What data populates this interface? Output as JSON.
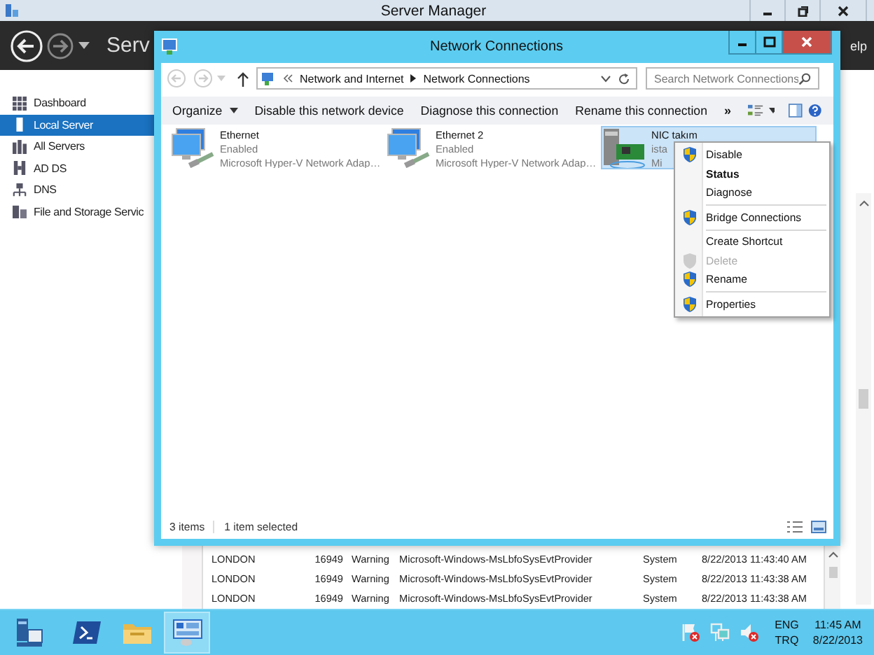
{
  "server_manager": {
    "title": "Server Manager",
    "header_title": "Serv",
    "header_right": "elp",
    "sidebar": [
      {
        "label": "Dashboard",
        "selected": false
      },
      {
        "label": "Local Server",
        "selected": true
      },
      {
        "label": "All Servers",
        "selected": false
      },
      {
        "label": "AD DS",
        "selected": false
      },
      {
        "label": "DNS",
        "selected": false
      },
      {
        "label": "File and Storage Servic",
        "selected": false
      }
    ],
    "events": [
      {
        "server": "LONDON",
        "id": "16949",
        "severity": "Warning",
        "source": "Microsoft-Windows-MsLbfoSysEvtProvider",
        "log": "System",
        "date": "8/22/2013 11:43:40 AM"
      },
      {
        "server": "LONDON",
        "id": "16949",
        "severity": "Warning",
        "source": "Microsoft-Windows-MsLbfoSysEvtProvider",
        "log": "System",
        "date": "8/22/2013 11:43:38 AM"
      },
      {
        "server": "LONDON",
        "id": "16949",
        "severity": "Warning",
        "source": "Microsoft-Windows-MsLbfoSysEvtProvider",
        "log": "System",
        "date": "8/22/2013 11:43:38 AM"
      }
    ]
  },
  "network_connections": {
    "title": "Network Connections",
    "breadcrumb": [
      "Network and Internet",
      "Network Connections"
    ],
    "search": {
      "placeholder": "Search Network Connections"
    },
    "commands": [
      {
        "label": "Organize",
        "dropdown": true
      },
      {
        "label": "Disable this network device",
        "dropdown": false
      },
      {
        "label": "Diagnose this connection",
        "dropdown": false
      },
      {
        "label": "Rename this connection",
        "dropdown": false
      }
    ],
    "more": "»",
    "adapters": [
      {
        "name": "Ethernet",
        "status": "Enabled",
        "device": "Microsoft Hyper-V Network Adap…",
        "kind": "monitor",
        "selected": false
      },
      {
        "name": "Ethernet 2",
        "status": "Enabled",
        "device": "Microsoft Hyper-V Network Adap…",
        "kind": "monitor",
        "selected": false
      },
      {
        "name": "NIC takım",
        "status": "ista",
        "device": "Mi",
        "kind": "card",
        "selected": true
      }
    ],
    "status_bar": {
      "count": "3 items",
      "selection": "1 item selected"
    }
  },
  "context_menu": {
    "groups": [
      [
        {
          "label": "Disable",
          "shield": true,
          "default": false,
          "disabled": false
        },
        {
          "label": "Status",
          "shield": false,
          "default": true,
          "disabled": false
        },
        {
          "label": "Diagnose",
          "shield": false,
          "default": false,
          "disabled": false
        }
      ],
      [
        {
          "label": "Bridge Connections",
          "shield": true,
          "default": false,
          "disabled": false
        }
      ],
      [
        {
          "label": "Create Shortcut",
          "shield": false,
          "default": false,
          "disabled": false
        },
        {
          "label": "Delete",
          "shield": true,
          "default": false,
          "disabled": true
        },
        {
          "label": "Rename",
          "shield": true,
          "default": false,
          "disabled": false
        }
      ],
      [
        {
          "label": "Properties",
          "shield": true,
          "default": false,
          "disabled": false
        }
      ]
    ]
  },
  "taskbar": {
    "apps": [
      {
        "kind": "powershell",
        "selected": false
      },
      {
        "kind": "explorer",
        "selected": false
      },
      {
        "kind": "server-manager",
        "selected": true
      }
    ]
  },
  "tray": {
    "language": "ENG",
    "layout": "TRQ",
    "time": "11:45 AM",
    "date": "8/22/2013"
  }
}
